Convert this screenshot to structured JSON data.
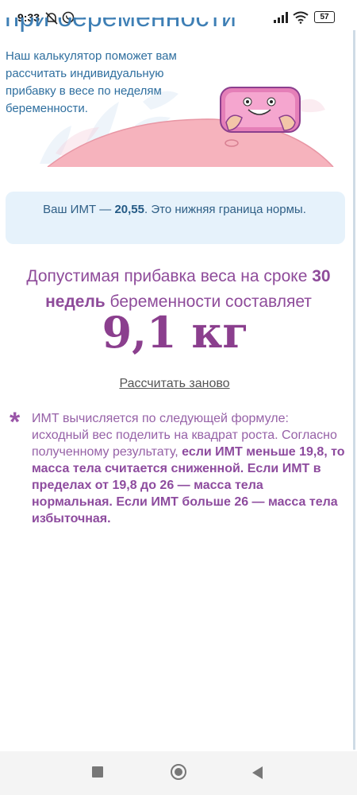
{
  "status_bar": {
    "time": "9:33",
    "battery": "57"
  },
  "header": {
    "title_partial": "при беременности"
  },
  "intro": {
    "text": "Наш калькулятор поможет вам рассчитать индивидуальную прибавку в весе по неделям беременности."
  },
  "bmi": {
    "prefix": "Ваш ИМТ — ",
    "value": "20,55",
    "suffix": ". Это нижняя граница нормы."
  },
  "result": {
    "part1": "Допустимая прибавка веса на сроке ",
    "weeks": "30 недель",
    "part2": " беременности составляет",
    "weight": "9,1 кг"
  },
  "recalc_label": "Рассчитать заново",
  "note": {
    "asterisk": "*",
    "text1": "ИМТ вычисляется по следующей формуле: исходный вес поделить на квадрат роста. Согласно полученному результату, ",
    "bold1": "если ИМТ меньше 19,8, то масса тела считается сниженной. Если ИМТ в пределах от 19,8 до 26 — масса тела нормальная. Если ИМТ больше 26 — масса тела избыточная."
  },
  "colors": {
    "accent_blue": "#2f6f9f",
    "accent_purple": "#8b3f8e",
    "bmi_box": "#e6f2fb",
    "belly_pink": "#f6b3bd",
    "scale_pink": "#e57fb8"
  }
}
